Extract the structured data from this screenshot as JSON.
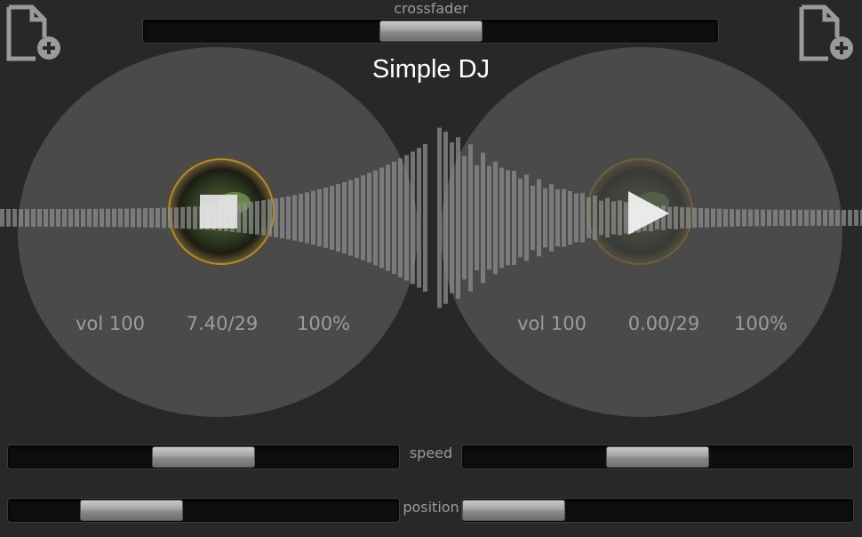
{
  "app": {
    "title": "Simple DJ"
  },
  "crossfader": {
    "label": "crossfader",
    "value": 0.5
  },
  "decks": [
    {
      "side": "left",
      "add_icon": "add-file-icon",
      "volume": "vol 100",
      "time": "7.40/29",
      "speed_percent": "100%",
      "transport_icon": "stop-icon",
      "record_state": "playing",
      "speed_value": 0.5,
      "position_value": 0.25
    },
    {
      "side": "right",
      "add_icon": "add-file-icon",
      "volume": "vol 100",
      "time": "0.00/29",
      "speed_percent": "100%",
      "transport_icon": "play-icon",
      "record_state": "paused",
      "speed_value": 0.5,
      "position_value": 0.0
    }
  ],
  "controls": {
    "speed_label": "speed",
    "position_label": "position"
  },
  "colors": {
    "background": "#282828",
    "platter": "#4a4a4a",
    "waveform": "#8c8c8c",
    "label_text": "#9c9c9c",
    "title_text": "#ffffff"
  }
}
